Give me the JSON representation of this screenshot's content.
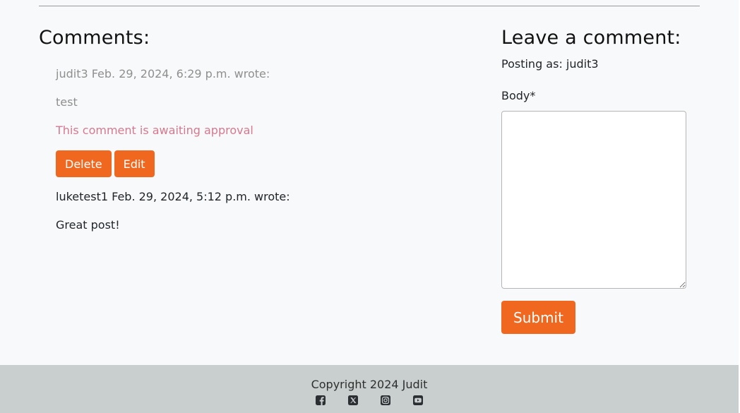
{
  "comments": {
    "title": "Comments:",
    "items": [
      {
        "author": "judit3",
        "date": "Feb. 29, 2024, 6:29 p.m.",
        "meta": "judit3 Feb. 29, 2024, 6:29 p.m. wrote:",
        "body": "test",
        "approval_note": "This comment is awaiting approval",
        "delete_label": "Delete",
        "edit_label": "Edit"
      },
      {
        "author": "luketest1",
        "date": "Feb. 29, 2024, 5:12 p.m.",
        "meta": "luketest1 Feb. 29, 2024, 5:12 p.m. wrote:",
        "body": "Great post!"
      }
    ]
  },
  "form": {
    "title": "Leave a comment:",
    "posting_as": "Posting as: judit3",
    "body_label": "Body*",
    "body_value": "",
    "submit_label": "Submit"
  },
  "footer": {
    "copyright": "Copyright 2024 Judit",
    "social_icons": [
      "facebook-icon",
      "x-twitter-icon",
      "instagram-icon",
      "youtube-icon"
    ]
  },
  "colors": {
    "accent": "#f06820",
    "approval_text": "#d5798f",
    "footer_bg": "#c8cfce",
    "page_bg": "#f8f9fa"
  }
}
